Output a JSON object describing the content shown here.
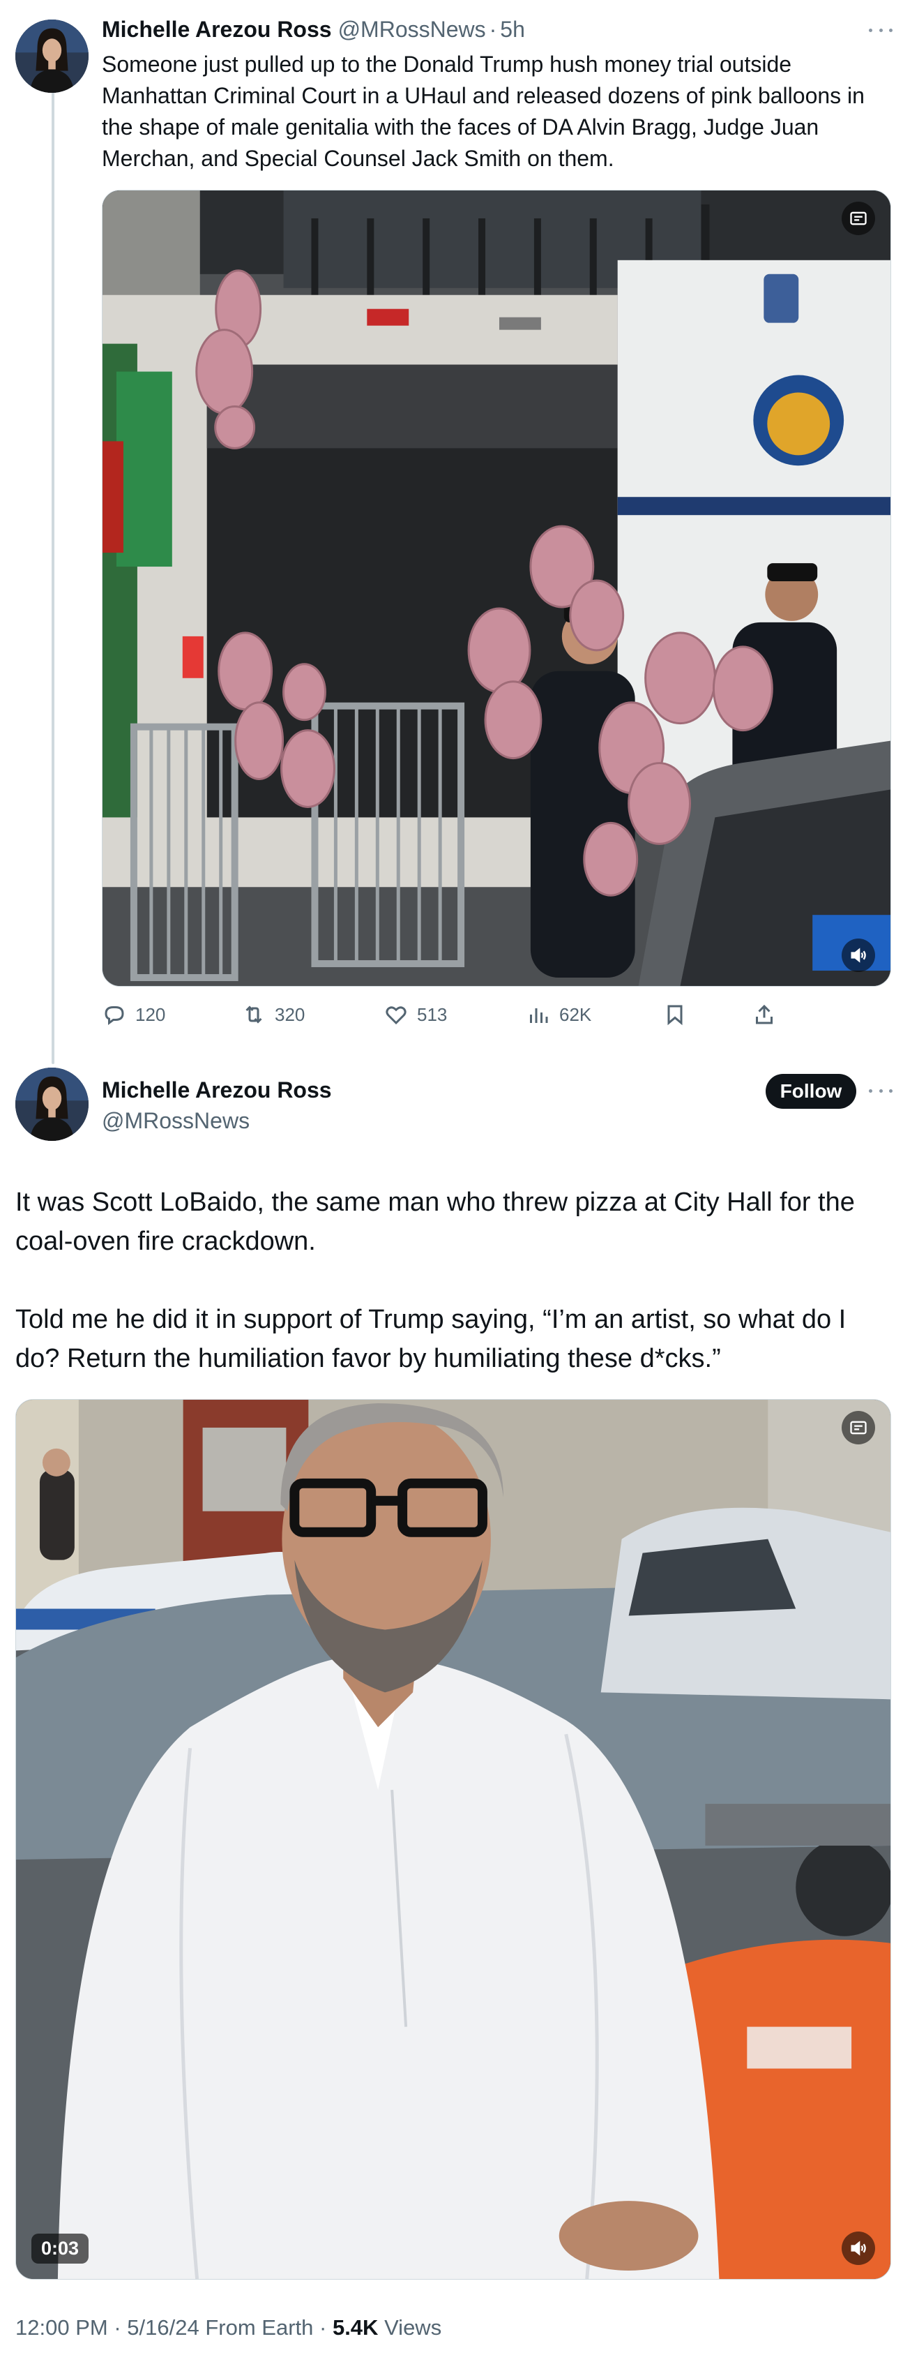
{
  "tweet1": {
    "author_name": "Michelle Arezou Ross",
    "author_handle": "@MRossNews",
    "separator": "·",
    "time": "5h",
    "text": "Someone just pulled up to the Donald Trump hush money trial outside Manhattan Criminal Court in a UHaul and released dozens of pink balloons in the shape of male genitalia with the faces of DA Alvin Bragg, Judge Juan Merchan, and Special Counsel Jack Smith on them.",
    "media_icons": [
      "alt-text-icon",
      "volume-icon"
    ],
    "actions": {
      "replies": "120",
      "reposts": "320",
      "likes": "513",
      "views": "62K"
    }
  },
  "tweet2": {
    "author_name": "Michelle Arezou Ross",
    "author_handle": "@MRossNews",
    "follow_label": "Follow",
    "paragraphs": [
      "It was Scott LoBaido, the same man who threw pizza at City Hall for the coal-oven fire crackdown.",
      "Told me he did it in support of Trump saying, “I’m an artist, so what do I do? Return the humiliation favor by humiliating these d*cks.”"
    ],
    "video_duration": "0:03",
    "media_icons": [
      "alt-text-icon",
      "volume-icon"
    ],
    "meta": {
      "time": "12:00 PM",
      "date": "5/16/24",
      "source": "From Earth",
      "separator": "·",
      "views_count": "5.4K",
      "views_label": "Views"
    }
  },
  "colors": {
    "text_primary": "#0f1419",
    "text_secondary": "#536471",
    "border": "#cfd9de",
    "follow_bg": "#0f1419",
    "balloon_pink": "#c98f9c"
  }
}
